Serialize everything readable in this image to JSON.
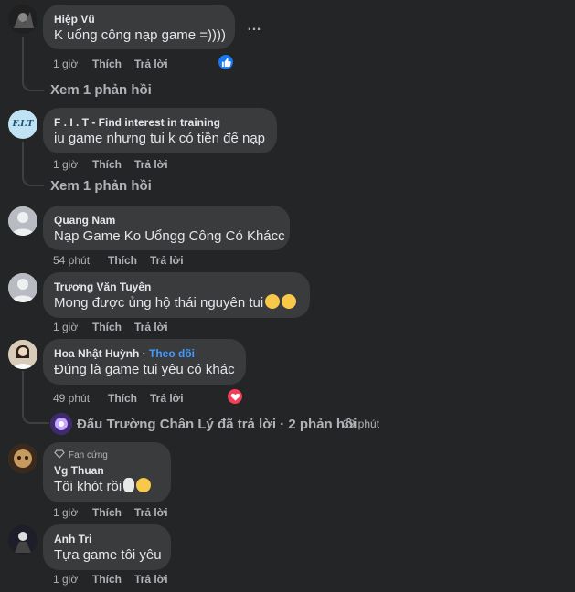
{
  "comments": [
    {
      "author": "Hiệp Vũ",
      "text": "K uổng công nạp game =))))",
      "time": "1 giờ",
      "like": "Thích",
      "reply": "Trả lời",
      "more_icon": "…",
      "reaction": "like-icon",
      "view_replies": "Xem 1 phản hồi"
    },
    {
      "author": "F . I . T - Find interest in training",
      "avatar_text": "F.I.T",
      "text": "iu game nhưng tui k có tiền để nạp",
      "time": "1 giờ",
      "like": "Thích",
      "reply": "Trả lời",
      "view_replies": "Xem 1 phản hồi"
    },
    {
      "author": "Quang Nam",
      "text": "Nạp Game Ko Uổngg Công Có Khácc",
      "time": "54 phút",
      "like": "Thích",
      "reply": "Trả lời"
    },
    {
      "author": "Trương Văn Tuyên",
      "text": "Mong được ủng hộ thái nguyên tui",
      "time": "1 giờ",
      "like": "Thích",
      "reply": "Trả lời"
    },
    {
      "author": "Hoa Nhật Huỳnh",
      "separator": " · ",
      "follow": "Theo dõi",
      "text": "Đúng là game tui yêu có khác",
      "time": "49 phút",
      "like": "Thích",
      "reply": "Trả lời",
      "reaction": "heart-icon",
      "reply_summary": "Đấu Trường Chân Lý đã trả lời · 2 phản hồi",
      "reply_time": "39 phút"
    },
    {
      "badge": "Fan cứng",
      "author": "Vg Thuan",
      "text": "Tôi khót rồi",
      "time": "1 giờ",
      "like": "Thích",
      "reply": "Trả lời"
    },
    {
      "author": "Anh Tri",
      "text": "Tựa game tôi yêu",
      "time": "1 giờ",
      "like": "Thích",
      "reply": "Trả lời"
    }
  ],
  "colors": {
    "background": "#242526",
    "bubble": "#3a3b3c",
    "text": "#e4e6eb",
    "muted": "#b0b3b8",
    "link": "#4599ff",
    "like_blue": "#1877f2",
    "heart_red": "#f33e58"
  }
}
